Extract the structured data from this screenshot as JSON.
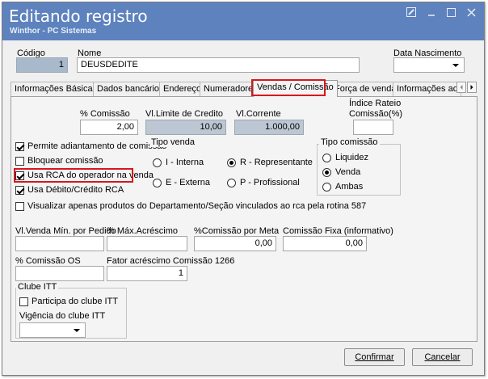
{
  "window": {
    "title": "Editando registro",
    "subtitle": "Winthor - PC Sistemas",
    "controls": [
      "edit",
      "minimize",
      "maximize",
      "close"
    ]
  },
  "header": {
    "codigo_label": "Código",
    "codigo_value": "1",
    "nome_label": "Nome",
    "nome_value": "DEUSDEDITE",
    "data_nasc_label": "Data Nascimento",
    "data_nasc_value": ""
  },
  "tabs": [
    {
      "label": "Informações Básicas",
      "active": false
    },
    {
      "label": "Dados bancários",
      "active": false
    },
    {
      "label": "Endereço",
      "active": false
    },
    {
      "label": "Numeradores",
      "active": false
    },
    {
      "label": "Vendas  / Comissão",
      "active": true
    },
    {
      "label": "Força de vendas",
      "active": false
    },
    {
      "label": "Informações adicion",
      "active": false
    }
  ],
  "vendas": {
    "pct_comissao_label": "% Comissão",
    "pct_comissao_value": "2,00",
    "vl_limite_label": "Vl.Limite de Credito",
    "vl_limite_value": "10,00",
    "vl_corrente_label": "Vl.Corrente",
    "vl_corrente_value": "1.000,00",
    "indice_rateio_label_1": "Índice Rateio",
    "indice_rateio_label_2": "Comissão(%)",
    "indice_rateio_value": ""
  },
  "checkboxes": {
    "permite_adiant": {
      "label": "Permite adiantamento de comissão",
      "checked": true
    },
    "bloquear": {
      "label": "Bloquear comissão",
      "checked": false
    },
    "usa_rca": {
      "label": "Usa RCA do operador na venda",
      "checked": true
    },
    "usa_debito": {
      "label": "Usa Débito/Crédito RCA",
      "checked": true
    },
    "visualizar": {
      "label": "Visualizar apenas produtos do Departamento/Seção vinculados ao rca pela rotina 587",
      "checked": false
    }
  },
  "tipo_venda": {
    "title": "Tipo venda",
    "options": [
      {
        "label": "I - Interna",
        "selected": false
      },
      {
        "label": "R - Representante",
        "selected": true
      },
      {
        "label": "E - Externa",
        "selected": false
      },
      {
        "label": "P - Profissional",
        "selected": false
      }
    ]
  },
  "tipo_comissao": {
    "title": "Tipo comissão",
    "options": [
      {
        "label": "Liquidez",
        "selected": false
      },
      {
        "label": "Venda",
        "selected": true
      },
      {
        "label": "Ambas",
        "selected": false
      }
    ]
  },
  "row2": {
    "vl_venda_min_label": "Vl.Venda Mín. por Pedido",
    "vl_venda_min_value": "",
    "pct_max_acresc_label": "% Máx.Acréscimo",
    "pct_max_acresc_value": "",
    "pct_comissao_meta_label": "%Comissão por Meta",
    "pct_comissao_meta_value": "0,00",
    "comissao_fixa_label": "Comissão Fixa (informativo)",
    "comissao_fixa_value": "0,00"
  },
  "row3": {
    "pct_comissao_os_label": "% Comissão OS",
    "pct_comissao_os_value": "",
    "fator_label": "Fator acréscimo Comissão 1266",
    "fator_value": "1"
  },
  "clube": {
    "title": "Clube ITT",
    "participa_label": "Participa do clube ITT",
    "participa_checked": false,
    "vigencia_label": "Vigência do clube ITT",
    "vigencia_value": ""
  },
  "buttons": {
    "confirmar": "Confirmar",
    "cancelar": "Cancelar"
  },
  "colors": {
    "titlebar": "#5d82bd",
    "highlight": "#d9151c"
  }
}
